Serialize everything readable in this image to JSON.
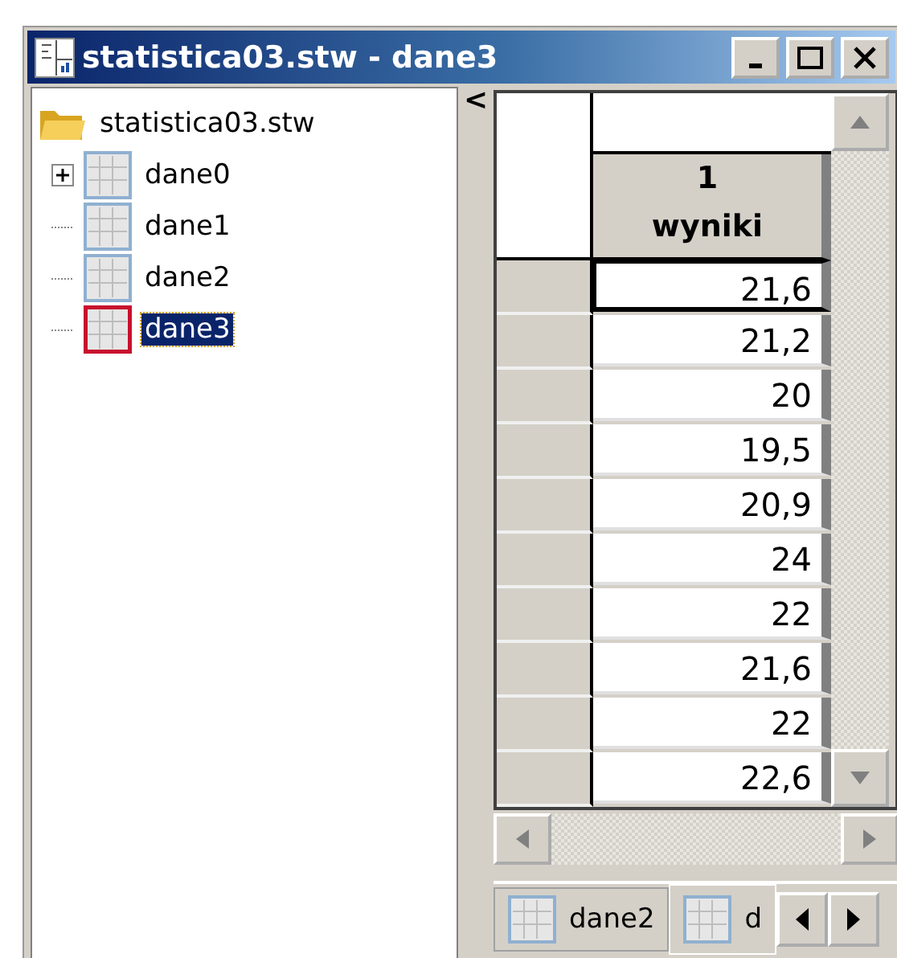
{
  "window": {
    "title": "statistica03.stw - dane3",
    "buttons": [
      {
        "kind": "minimize"
      },
      {
        "kind": "maximize"
      },
      {
        "kind": "close"
      }
    ]
  },
  "tree": {
    "root": {
      "label": "statistica03.stw",
      "children": [
        {
          "label": "dane0",
          "selected": false,
          "expandable": true
        },
        {
          "label": "dane1",
          "selected": false,
          "expandable": false
        },
        {
          "label": "dane2",
          "selected": false,
          "expandable": false
        },
        {
          "label": "dane3",
          "selected": true,
          "expandable": false
        }
      ]
    }
  },
  "splitter": {
    "label": "<"
  },
  "sheet": {
    "column": {
      "number": "1",
      "name": "wyniki"
    },
    "rows": [
      {
        "value": "21,6",
        "selected": true
      },
      {
        "value": "21,2",
        "selected": false
      },
      {
        "value": "20",
        "selected": false
      },
      {
        "value": "19,5",
        "selected": false
      },
      {
        "value": "20,9",
        "selected": false
      },
      {
        "value": "24",
        "selected": false
      },
      {
        "value": "22",
        "selected": false
      },
      {
        "value": "21,6",
        "selected": false
      },
      {
        "value": "22",
        "selected": false
      },
      {
        "value": "22,6",
        "selected": false
      }
    ]
  },
  "tabs": [
    {
      "label": "dane2",
      "selected": false
    },
    {
      "label": "d",
      "selected": true
    }
  ]
}
